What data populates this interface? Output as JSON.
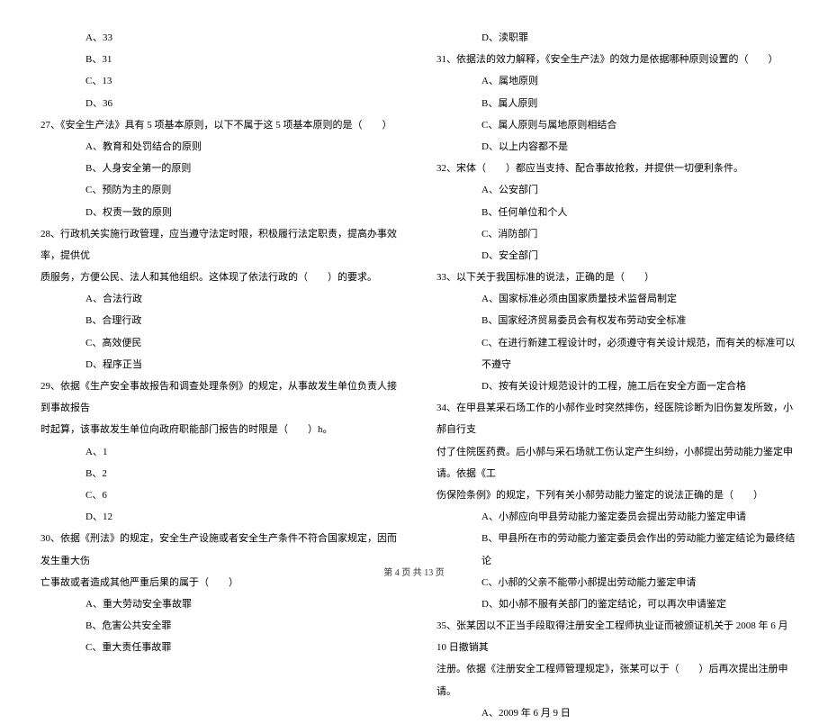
{
  "left_column": {
    "q26_options": [
      {
        "label": "A、33"
      },
      {
        "label": "B、31"
      },
      {
        "label": "C、13"
      },
      {
        "label": "D、36"
      }
    ],
    "q27": {
      "text": "27、《安全生产法》具有 5 项基本原则，以下不属于这 5 项基本原则的是（　　）",
      "options": [
        {
          "label": "A、教育和处罚结合的原则"
        },
        {
          "label": "B、人身安全第一的原则"
        },
        {
          "label": "C、预防为主的原则"
        },
        {
          "label": "D、权责一致的原则"
        }
      ]
    },
    "q28": {
      "line1": "28、行政机关实施行政管理，应当遵守法定时限，积极履行法定职责，提高办事效率，提供优",
      "line2": "质服务，方便公民、法人和其他组织。这体现了依法行政的（　　）的要求。",
      "options": [
        {
          "label": "A、合法行政"
        },
        {
          "label": "B、合理行政"
        },
        {
          "label": "C、高效便民"
        },
        {
          "label": "D、程序正当"
        }
      ]
    },
    "q29": {
      "line1": "29、依据《生产安全事故报告和调查处理条例》的规定，从事故发生单位负责人接到事故报告",
      "line2": "时起算，该事故发生单位向政府职能部门报告的时限是（　　）h。",
      "options": [
        {
          "label": "A、1"
        },
        {
          "label": "B、2"
        },
        {
          "label": "C、6"
        },
        {
          "label": "D、12"
        }
      ]
    },
    "q30": {
      "line1": "30、依据《刑法》的规定，安全生产设施或者安全生产条件不符合国家规定，因而发生重大伤",
      "line2": "亡事故或者造成其他严重后果的属于（　　）",
      "options": [
        {
          "label": "A、重大劳动安全事故罪"
        },
        {
          "label": "B、危害公共安全罪"
        },
        {
          "label": "C、重大责任事故罪"
        }
      ]
    }
  },
  "right_column": {
    "q30_d": {
      "label": "D、渎职罪"
    },
    "q31": {
      "text": "31、依据法的效力解释，《安全生产法》的效力是依据哪种原则设置的（　　）",
      "options": [
        {
          "label": "A、属地原则"
        },
        {
          "label": "B、属人原则"
        },
        {
          "label": "C、属人原则与属地原则相结合"
        },
        {
          "label": "D、以上内容都不是"
        }
      ]
    },
    "q32": {
      "text": "32、宋体（　　）都应当支持、配合事故抢救，并提供一切便利条件。",
      "options": [
        {
          "label": "A、公安部门"
        },
        {
          "label": "B、任何单位和个人"
        },
        {
          "label": "C、消防部门"
        },
        {
          "label": "D、安全部门"
        }
      ]
    },
    "q33": {
      "text": "33、以下关于我国标准的说法，正确的是（　　）",
      "options": [
        {
          "label": "A、国家标准必须由国家质量技术监督局制定"
        },
        {
          "label": "B、国家经济贸易委员会有权发布劳动安全标准"
        },
        {
          "label": "C、在进行新建工程设计时，必须遵守有关设计规范，而有关的标准可以不遵守"
        },
        {
          "label": "D、按有关设计规范设计的工程，施工后在安全方面一定合格"
        }
      ]
    },
    "q34": {
      "line1": "34、在甲县某采石场工作的小郝作业时突然摔伤，经医院诊断为旧伤复发所致，小郝自行支",
      "line2": "付了住院医药费。后小郝与采石场就工伤认定产生纠纷，小郝提出劳动能力鉴定申请。依据《工",
      "line3": "伤保险条例》的规定，下列有关小郝劳动能力鉴定的说法正确的是（　　）",
      "options": [
        {
          "label": "A、小郝应向甲县劳动能力鉴定委员会提出劳动能力鉴定申请"
        },
        {
          "label": "B、甲县所在市的劳动能力鉴定委员会作出的劳动能力鉴定结论为最终结论"
        },
        {
          "label": "C、小郝的父亲不能带小郝提出劳动能力鉴定申请"
        },
        {
          "label": "D、如小郝不服有关部门的鉴定结论，可以再次申请鉴定"
        }
      ]
    },
    "q35": {
      "line1": "35、张某因以不正当手段取得注册安全工程师执业证而被颁证机关于 2008 年 6 月 10 日撤销其",
      "line2": "注册。依据《注册安全工程师管理规定》，张某可以于（　　）后再次提出注册申请。",
      "options": [
        {
          "label": "A、2009 年 6 月 9 日"
        }
      ]
    }
  },
  "footer": "第 4 页 共 13 页"
}
